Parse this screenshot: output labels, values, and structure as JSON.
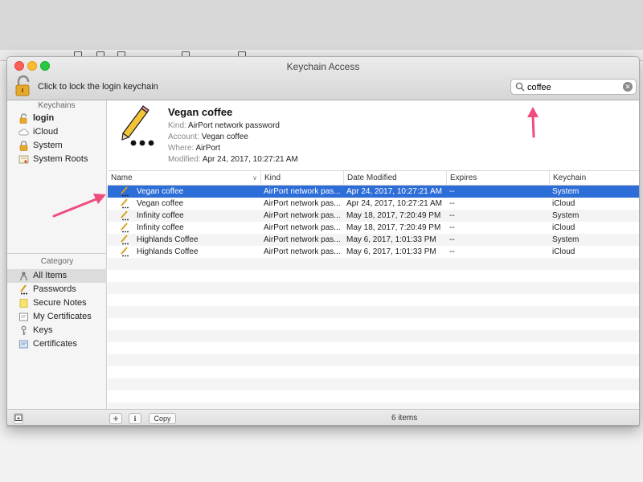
{
  "window": {
    "title": "Keychain Access",
    "lock_hint": "Click to lock the login keychain"
  },
  "search": {
    "value": "coffee"
  },
  "sidebar": {
    "keychains_heading": "Keychains",
    "keychains": [
      {
        "label": "login",
        "icon": "unlocked-padlock-icon"
      },
      {
        "label": "iCloud",
        "icon": "cloud-icon"
      },
      {
        "label": "System",
        "icon": "locked-padlock-icon"
      },
      {
        "label": "System Roots",
        "icon": "certificate-stack-icon"
      }
    ],
    "category_heading": "Category",
    "categories": [
      {
        "label": "All Items",
        "icon": "people-icon"
      },
      {
        "label": "Passwords",
        "icon": "pencil-dots-icon"
      },
      {
        "label": "Secure Notes",
        "icon": "note-icon"
      },
      {
        "label": "My Certificates",
        "icon": "certificate-icon"
      },
      {
        "label": "Keys",
        "icon": "key-icon"
      },
      {
        "label": "Certificates",
        "icon": "certificate-icon"
      }
    ]
  },
  "detail": {
    "name": "Vegan coffee",
    "kind_label": "Kind:",
    "kind": "AirPort network password",
    "account_label": "Account:",
    "account": "Vegan coffee",
    "where_label": "Where:",
    "where": "AirPort",
    "modified_label": "Modified:",
    "modified": "Apr 24, 2017, 10:27:21 AM",
    "icon": "password-pencil-icon"
  },
  "table": {
    "columns": [
      "Name",
      "Kind",
      "Date Modified",
      "Expires",
      "Keychain"
    ],
    "rows": [
      {
        "name": "Vegan coffee",
        "kind": "AirPort network pas...",
        "date": "Apr 24, 2017, 10:27:21 AM",
        "expires": "--",
        "keychain": "System"
      },
      {
        "name": "Vegan coffee",
        "kind": "AirPort network pas...",
        "date": "Apr 24, 2017, 10:27:21 AM",
        "expires": "--",
        "keychain": "iCloud"
      },
      {
        "name": "Infinity coffee",
        "kind": "AirPort network pas...",
        "date": "May 18, 2017, 7:20:49 PM",
        "expires": "--",
        "keychain": "System"
      },
      {
        "name": "Infinity coffee",
        "kind": "AirPort network pas...",
        "date": "May 18, 2017, 7:20:49 PM",
        "expires": "--",
        "keychain": "iCloud"
      },
      {
        "name": "Highlands Coffee",
        "kind": "AirPort network pas...",
        "date": "May 6, 2017, 1:01:33 PM",
        "expires": "--",
        "keychain": "System"
      },
      {
        "name": "Highlands Coffee",
        "kind": "AirPort network pas...",
        "date": "May 6, 2017, 1:01:33 PM",
        "expires": "--",
        "keychain": "iCloud"
      }
    ],
    "selected_row": 0
  },
  "bottombar": {
    "add_label": "+",
    "info_label": "i",
    "copy_label": "Copy",
    "item_count": "6 items"
  },
  "colors": {
    "selection": "#2d6dd7",
    "annotation_arrow": "#ee4d7d",
    "close": "#fc5f57",
    "minimize": "#fdbc2e",
    "maximize": "#28c840"
  }
}
